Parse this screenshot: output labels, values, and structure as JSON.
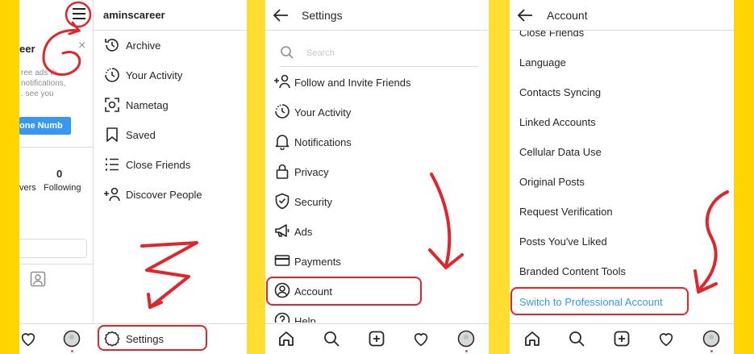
{
  "menu": {
    "username": "aminscareer",
    "items": [
      {
        "label": "Archive",
        "icon": "archive-icon"
      },
      {
        "label": "Your Activity",
        "icon": "activity-icon"
      },
      {
        "label": "Nametag",
        "icon": "nametag-icon"
      },
      {
        "label": "Saved",
        "icon": "bookmark-icon"
      },
      {
        "label": "Close Friends",
        "icon": "close-friends-icon"
      },
      {
        "label": "Discover People",
        "icon": "add-person-icon"
      }
    ],
    "settings_label": "Settings",
    "profile_fragment": {
      "name_partial": "eer",
      "suggest_text_lines": [
        "ree ads th",
        "notifications,",
        ". see you"
      ],
      "phone_button_partial": "one Numb",
      "followers_partial": "vers",
      "following_count": "0",
      "following_label": "Following",
      "close_symbol": "×"
    }
  },
  "settings": {
    "title": "Settings",
    "search_placeholder": "Search",
    "items": [
      {
        "label": "Follow and Invite Friends",
        "icon": "add-person-icon"
      },
      {
        "label": "Your Activity",
        "icon": "activity-icon"
      },
      {
        "label": "Notifications",
        "icon": "bell-icon"
      },
      {
        "label": "Privacy",
        "icon": "lock-icon"
      },
      {
        "label": "Security",
        "icon": "shield-icon"
      },
      {
        "label": "Ads",
        "icon": "megaphone-icon"
      },
      {
        "label": "Payments",
        "icon": "card-icon"
      },
      {
        "label": "Account",
        "icon": "account-icon"
      },
      {
        "label": "Help",
        "icon": "help-icon"
      }
    ]
  },
  "account": {
    "title": "Account",
    "items": [
      {
        "label": "Close Friends"
      },
      {
        "label": "Language"
      },
      {
        "label": "Contacts Syncing"
      },
      {
        "label": "Linked Accounts"
      },
      {
        "label": "Cellular Data Use"
      },
      {
        "label": "Original Posts"
      },
      {
        "label": "Request Verification"
      },
      {
        "label": "Posts You've Liked"
      },
      {
        "label": "Branded Content Tools"
      },
      {
        "label": "Switch to Professional Account"
      }
    ]
  },
  "colors": {
    "background": "#FFD400",
    "highlight": "#e0262d",
    "link_blue": "#3897f0",
    "text": "#262626"
  }
}
